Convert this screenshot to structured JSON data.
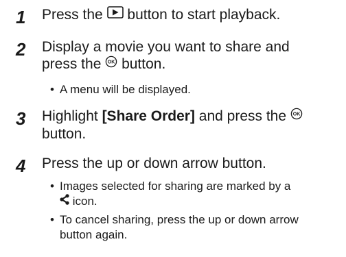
{
  "steps": [
    {
      "number": "1",
      "text_before": "Press the",
      "icon": "play-icon",
      "text_after": "button to start playback."
    },
    {
      "number": "2",
      "line1": "Display a movie you want to share and",
      "line2_before": "press the",
      "icon": "ok-icon",
      "line2_after": "button.",
      "bullet": "A menu will be displayed."
    },
    {
      "number": "3",
      "text_before": "Highlight",
      "bold": "[Share Order]",
      "text_mid": "and press the",
      "icon": "ok-icon",
      "line2": "button."
    },
    {
      "number": "4",
      "text": "Press the up or down arrow button.",
      "bullet1_line1": "Images selected for sharing are marked by a",
      "bullet1_icon": "share-icon",
      "bullet1_line2_after": "icon.",
      "bullet2_line1": "To cancel sharing, press the up or down arrow",
      "bullet2_line2": "button again."
    }
  ],
  "bullet_char": "•"
}
